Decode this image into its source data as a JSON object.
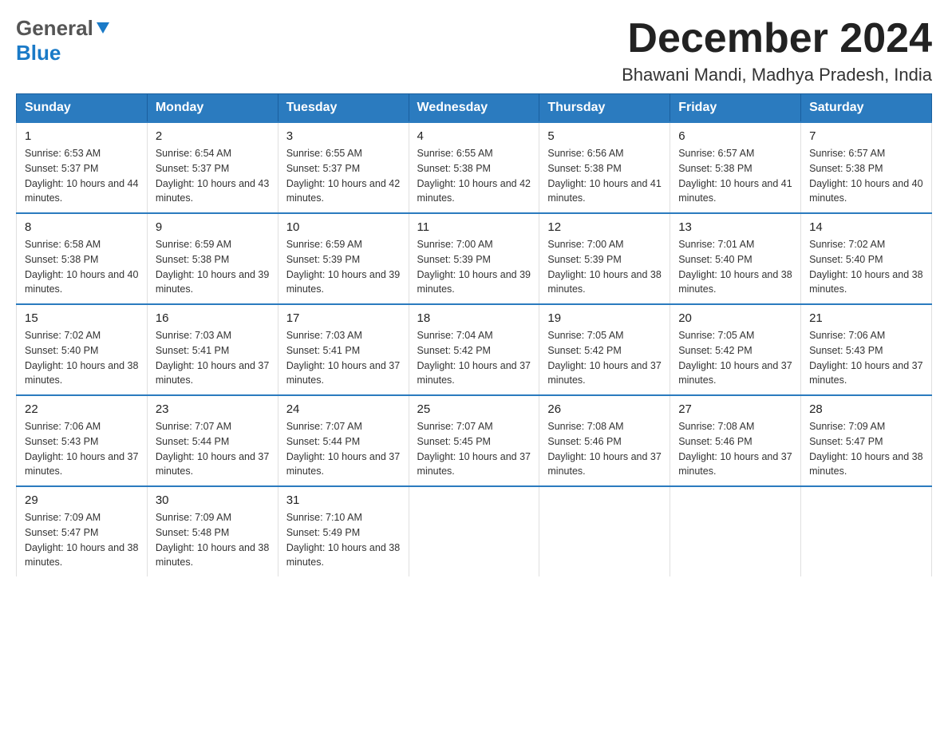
{
  "header": {
    "logo_general": "General",
    "logo_blue": "Blue",
    "month_title": "December 2024",
    "location": "Bhawani Mandi, Madhya Pradesh, India"
  },
  "days_of_week": [
    "Sunday",
    "Monday",
    "Tuesday",
    "Wednesday",
    "Thursday",
    "Friday",
    "Saturday"
  ],
  "weeks": [
    [
      {
        "day": "1",
        "sunrise": "Sunrise: 6:53 AM",
        "sunset": "Sunset: 5:37 PM",
        "daylight": "Daylight: 10 hours and 44 minutes."
      },
      {
        "day": "2",
        "sunrise": "Sunrise: 6:54 AM",
        "sunset": "Sunset: 5:37 PM",
        "daylight": "Daylight: 10 hours and 43 minutes."
      },
      {
        "day": "3",
        "sunrise": "Sunrise: 6:55 AM",
        "sunset": "Sunset: 5:37 PM",
        "daylight": "Daylight: 10 hours and 42 minutes."
      },
      {
        "day": "4",
        "sunrise": "Sunrise: 6:55 AM",
        "sunset": "Sunset: 5:38 PM",
        "daylight": "Daylight: 10 hours and 42 minutes."
      },
      {
        "day": "5",
        "sunrise": "Sunrise: 6:56 AM",
        "sunset": "Sunset: 5:38 PM",
        "daylight": "Daylight: 10 hours and 41 minutes."
      },
      {
        "day": "6",
        "sunrise": "Sunrise: 6:57 AM",
        "sunset": "Sunset: 5:38 PM",
        "daylight": "Daylight: 10 hours and 41 minutes."
      },
      {
        "day": "7",
        "sunrise": "Sunrise: 6:57 AM",
        "sunset": "Sunset: 5:38 PM",
        "daylight": "Daylight: 10 hours and 40 minutes."
      }
    ],
    [
      {
        "day": "8",
        "sunrise": "Sunrise: 6:58 AM",
        "sunset": "Sunset: 5:38 PM",
        "daylight": "Daylight: 10 hours and 40 minutes."
      },
      {
        "day": "9",
        "sunrise": "Sunrise: 6:59 AM",
        "sunset": "Sunset: 5:38 PM",
        "daylight": "Daylight: 10 hours and 39 minutes."
      },
      {
        "day": "10",
        "sunrise": "Sunrise: 6:59 AM",
        "sunset": "Sunset: 5:39 PM",
        "daylight": "Daylight: 10 hours and 39 minutes."
      },
      {
        "day": "11",
        "sunrise": "Sunrise: 7:00 AM",
        "sunset": "Sunset: 5:39 PM",
        "daylight": "Daylight: 10 hours and 39 minutes."
      },
      {
        "day": "12",
        "sunrise": "Sunrise: 7:00 AM",
        "sunset": "Sunset: 5:39 PM",
        "daylight": "Daylight: 10 hours and 38 minutes."
      },
      {
        "day": "13",
        "sunrise": "Sunrise: 7:01 AM",
        "sunset": "Sunset: 5:40 PM",
        "daylight": "Daylight: 10 hours and 38 minutes."
      },
      {
        "day": "14",
        "sunrise": "Sunrise: 7:02 AM",
        "sunset": "Sunset: 5:40 PM",
        "daylight": "Daylight: 10 hours and 38 minutes."
      }
    ],
    [
      {
        "day": "15",
        "sunrise": "Sunrise: 7:02 AM",
        "sunset": "Sunset: 5:40 PM",
        "daylight": "Daylight: 10 hours and 38 minutes."
      },
      {
        "day": "16",
        "sunrise": "Sunrise: 7:03 AM",
        "sunset": "Sunset: 5:41 PM",
        "daylight": "Daylight: 10 hours and 37 minutes."
      },
      {
        "day": "17",
        "sunrise": "Sunrise: 7:03 AM",
        "sunset": "Sunset: 5:41 PM",
        "daylight": "Daylight: 10 hours and 37 minutes."
      },
      {
        "day": "18",
        "sunrise": "Sunrise: 7:04 AM",
        "sunset": "Sunset: 5:42 PM",
        "daylight": "Daylight: 10 hours and 37 minutes."
      },
      {
        "day": "19",
        "sunrise": "Sunrise: 7:05 AM",
        "sunset": "Sunset: 5:42 PM",
        "daylight": "Daylight: 10 hours and 37 minutes."
      },
      {
        "day": "20",
        "sunrise": "Sunrise: 7:05 AM",
        "sunset": "Sunset: 5:42 PM",
        "daylight": "Daylight: 10 hours and 37 minutes."
      },
      {
        "day": "21",
        "sunrise": "Sunrise: 7:06 AM",
        "sunset": "Sunset: 5:43 PM",
        "daylight": "Daylight: 10 hours and 37 minutes."
      }
    ],
    [
      {
        "day": "22",
        "sunrise": "Sunrise: 7:06 AM",
        "sunset": "Sunset: 5:43 PM",
        "daylight": "Daylight: 10 hours and 37 minutes."
      },
      {
        "day": "23",
        "sunrise": "Sunrise: 7:07 AM",
        "sunset": "Sunset: 5:44 PM",
        "daylight": "Daylight: 10 hours and 37 minutes."
      },
      {
        "day": "24",
        "sunrise": "Sunrise: 7:07 AM",
        "sunset": "Sunset: 5:44 PM",
        "daylight": "Daylight: 10 hours and 37 minutes."
      },
      {
        "day": "25",
        "sunrise": "Sunrise: 7:07 AM",
        "sunset": "Sunset: 5:45 PM",
        "daylight": "Daylight: 10 hours and 37 minutes."
      },
      {
        "day": "26",
        "sunrise": "Sunrise: 7:08 AM",
        "sunset": "Sunset: 5:46 PM",
        "daylight": "Daylight: 10 hours and 37 minutes."
      },
      {
        "day": "27",
        "sunrise": "Sunrise: 7:08 AM",
        "sunset": "Sunset: 5:46 PM",
        "daylight": "Daylight: 10 hours and 37 minutes."
      },
      {
        "day": "28",
        "sunrise": "Sunrise: 7:09 AM",
        "sunset": "Sunset: 5:47 PM",
        "daylight": "Daylight: 10 hours and 38 minutes."
      }
    ],
    [
      {
        "day": "29",
        "sunrise": "Sunrise: 7:09 AM",
        "sunset": "Sunset: 5:47 PM",
        "daylight": "Daylight: 10 hours and 38 minutes."
      },
      {
        "day": "30",
        "sunrise": "Sunrise: 7:09 AM",
        "sunset": "Sunset: 5:48 PM",
        "daylight": "Daylight: 10 hours and 38 minutes."
      },
      {
        "day": "31",
        "sunrise": "Sunrise: 7:10 AM",
        "sunset": "Sunset: 5:49 PM",
        "daylight": "Daylight: 10 hours and 38 minutes."
      },
      null,
      null,
      null,
      null
    ]
  ]
}
